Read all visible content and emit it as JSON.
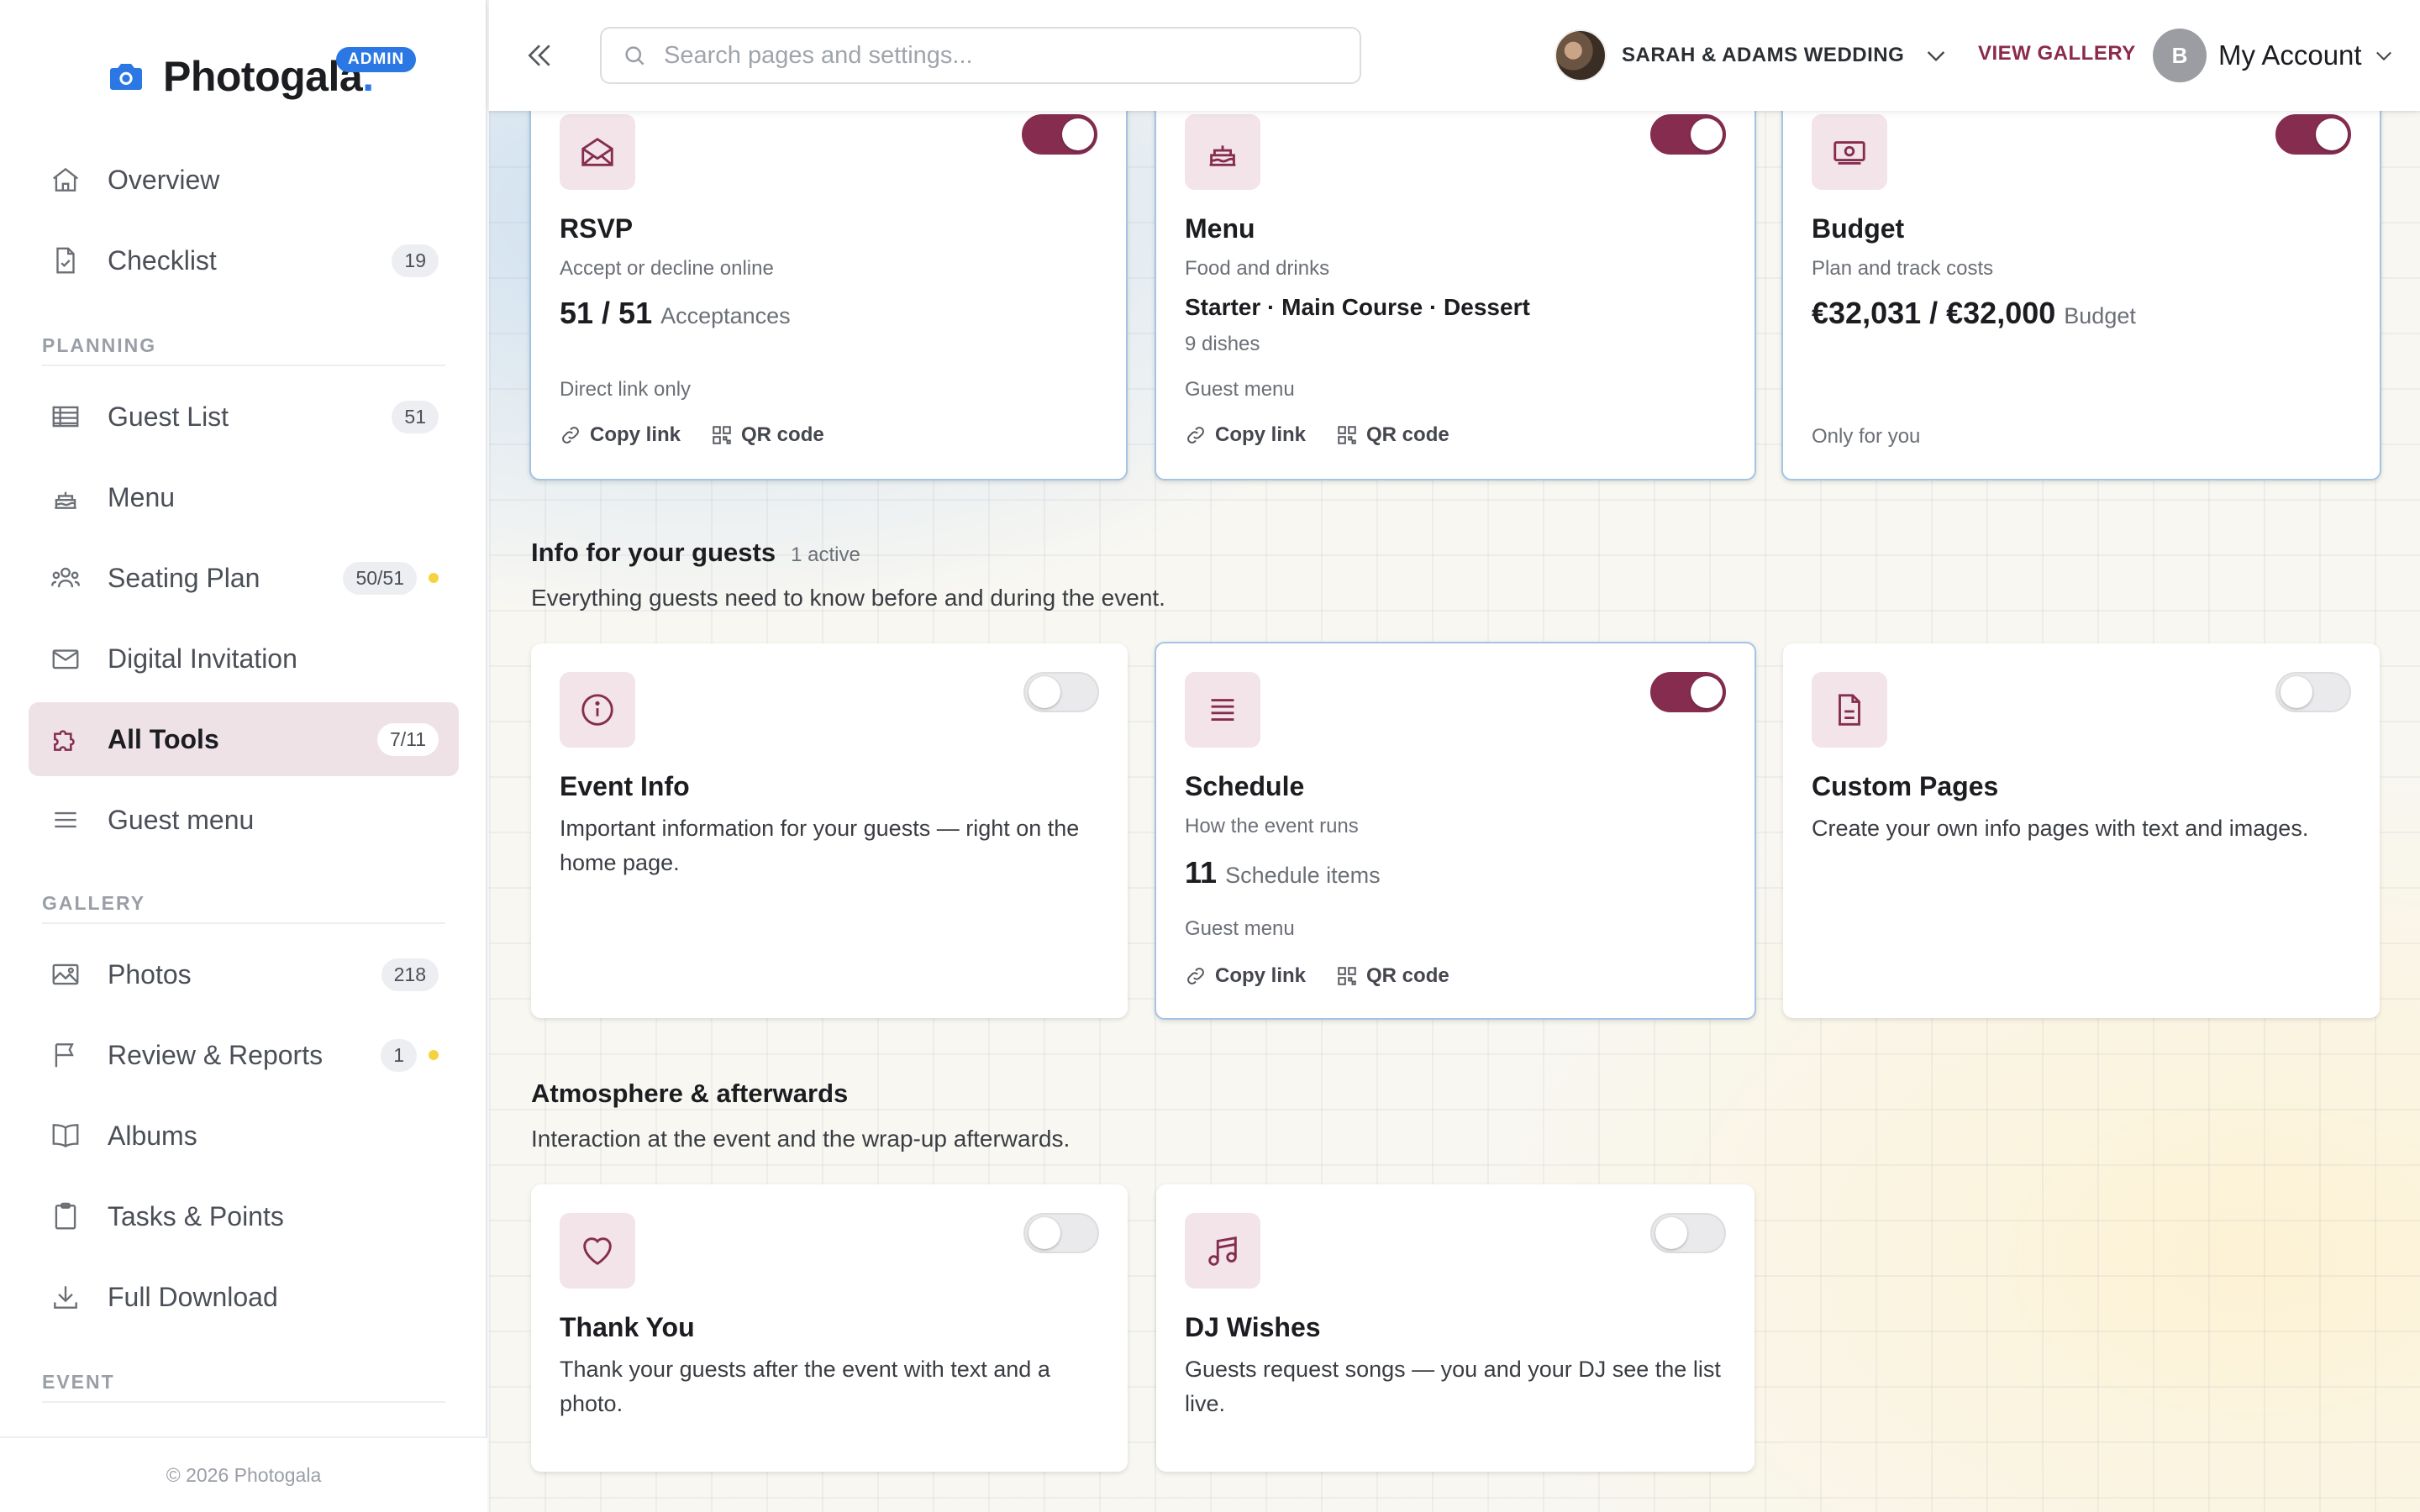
{
  "brand": {
    "name": "Photogala",
    "dot": ".",
    "badge": "ADMIN"
  },
  "sidebar": {
    "items": [
      {
        "label": "Overview",
        "badge": ""
      },
      {
        "label": "Checklist",
        "badge": "19"
      },
      {
        "label": "Guest List",
        "badge": "51"
      },
      {
        "label": "Menu",
        "badge": ""
      },
      {
        "label": "Seating Plan",
        "badge": "50/51"
      },
      {
        "label": "Digital Invitation",
        "badge": ""
      },
      {
        "label": "All Tools",
        "badge": "7/11"
      },
      {
        "label": "Guest menu",
        "badge": ""
      },
      {
        "label": "Photos",
        "badge": "218"
      },
      {
        "label": "Review & Reports",
        "badge": "1"
      },
      {
        "label": "Albums",
        "badge": ""
      },
      {
        "label": "Tasks & Points",
        "badge": ""
      },
      {
        "label": "Full Download",
        "badge": ""
      }
    ],
    "sections": {
      "planning": "PLANNING",
      "gallery": "GALLERY",
      "event": "EVENT"
    },
    "footer": "© 2026 Photogala"
  },
  "topbar": {
    "search_placeholder": "Search pages and settings...",
    "event_name": "SARAH & ADAMS WEDDING",
    "view_gallery": "VIEW GALLERY",
    "account_initial": "B",
    "account_label": "My Account"
  },
  "top_cards": {
    "rsvp": {
      "title": "RSVP",
      "subtitle": "Accept or decline online",
      "stat_big": "51 / 51",
      "stat_small": "Acceptances",
      "note": "Direct link only",
      "copy": "Copy link",
      "qr": "QR code"
    },
    "menu": {
      "title": "Menu",
      "subtitle": "Food and drinks",
      "courses": "Starter · Main Course · Dessert",
      "dishes": "9 dishes",
      "note": "Guest menu",
      "copy": "Copy link",
      "qr": "QR code"
    },
    "budget": {
      "title": "Budget",
      "subtitle": "Plan and track costs",
      "stat_big": "€32,031 / €32,000",
      "stat_small": "Budget",
      "note": "Only for you"
    }
  },
  "groups": {
    "info": {
      "title": "Info for your guests",
      "count": "1 active",
      "desc": "Everything guests need to know before and during the event."
    },
    "atmosphere": {
      "title": "Atmosphere & afterwards",
      "desc": "Interaction at the event and the wrap-up afterwards."
    }
  },
  "info_cards": {
    "event_info": {
      "title": "Event Info",
      "desc": "Important information for your guests — right on the home page."
    },
    "schedule": {
      "title": "Schedule",
      "subtitle": "How the event runs",
      "stat_big": "11",
      "stat_small": "Schedule items",
      "note": "Guest menu",
      "copy": "Copy link",
      "qr": "QR code"
    },
    "custom_pages": {
      "title": "Custom Pages",
      "desc": "Create your own info pages with text and images."
    }
  },
  "atmo_cards": {
    "thank_you": {
      "title": "Thank You",
      "desc": "Thank your guests after the event with text and a photo."
    },
    "dj_wishes": {
      "title": "DJ Wishes",
      "desc": "Guests request songs — you and your DJ see the list live."
    }
  },
  "colors": {
    "accent": "#862d4f",
    "brand_blue": "#2b78e4",
    "badge_dot": "#f5d33f"
  }
}
